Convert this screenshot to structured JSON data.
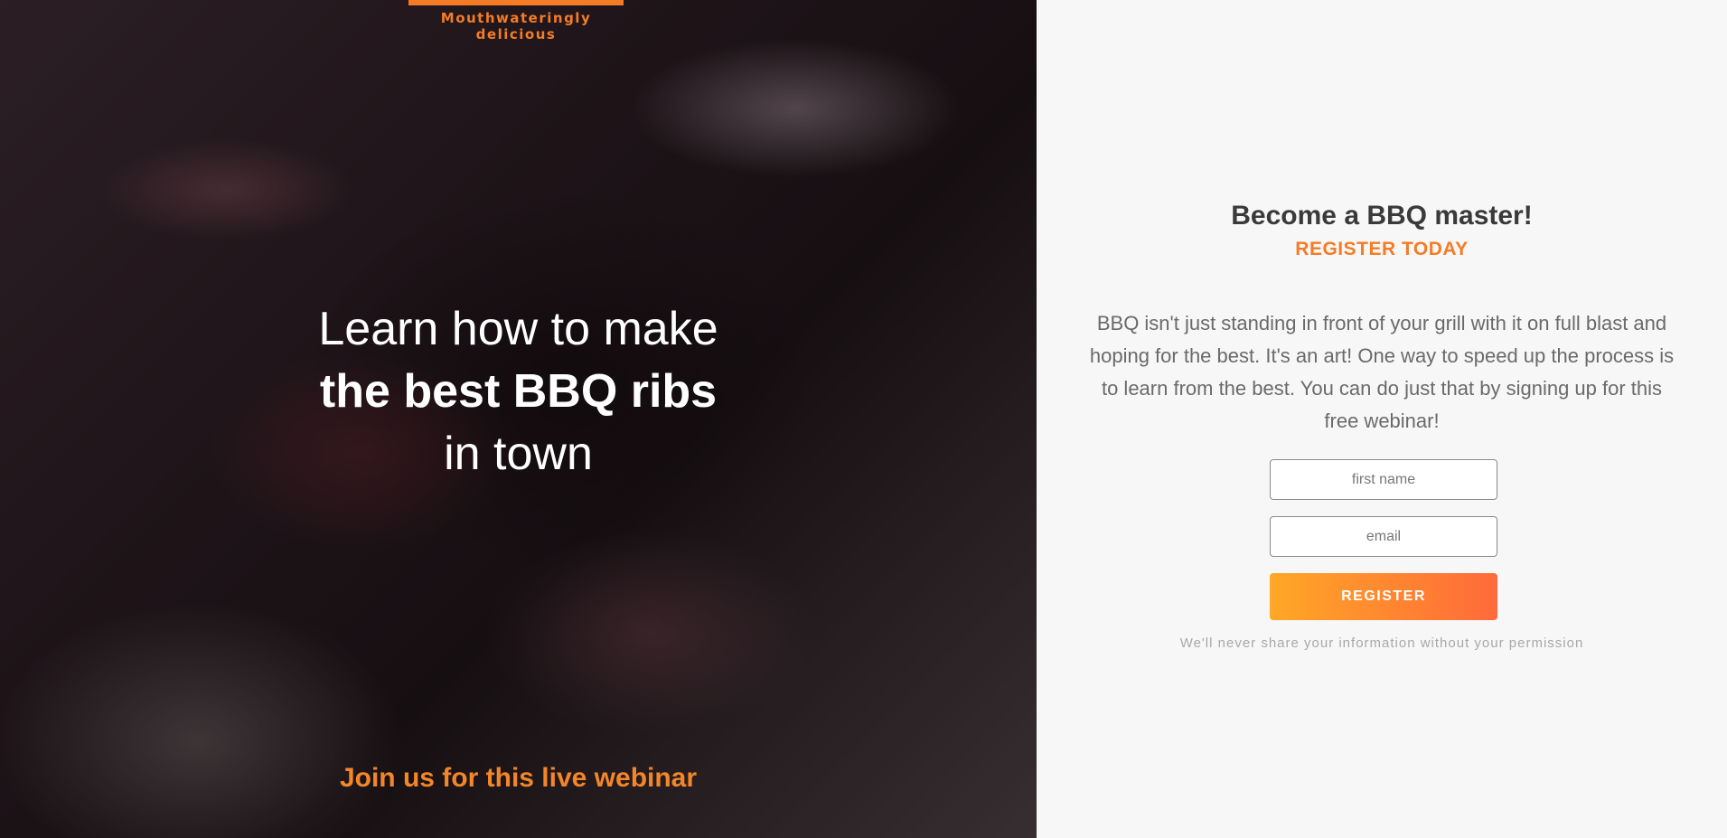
{
  "hero": {
    "tagline": "Mouthwateringly delicious",
    "headline_line1": "Learn how to make",
    "headline_line2": "the best BBQ ribs",
    "headline_line3": "in town",
    "cta": "Join us for this live webinar"
  },
  "panel": {
    "title": "Become a BBQ master!",
    "subtitle": "REGISTER TODAY",
    "description": "BBQ isn't just standing in front of your grill with it on full blast and hoping for the best. It's an art! One way to speed up the process is to learn from the best. You can do just that by signing up for this free webinar!",
    "form": {
      "first_name_placeholder": "first name",
      "email_placeholder": "email",
      "register_label": "REGISTER"
    },
    "privacy_note": "We'll never share your information without your permission"
  },
  "colors": {
    "accent": "#f47c26",
    "button_gradient_start": "#ffa726",
    "button_gradient_end": "#ff6a3a",
    "panel_background": "#f7f7f7"
  }
}
